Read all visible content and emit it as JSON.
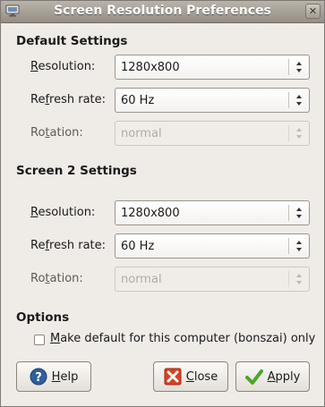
{
  "window": {
    "title": "Screen Resolution Preferences"
  },
  "default_settings": {
    "heading": "Default Settings",
    "resolution": {
      "label_u": "R",
      "label_rest": "esolution:",
      "value": "1280x800"
    },
    "refresh_rate": {
      "label_pre": "Re",
      "label_u": "f",
      "label_rest": "resh rate:",
      "value": "60 Hz"
    },
    "rotation": {
      "label_pre": "Ro",
      "label_u": "t",
      "label_rest": "ation:",
      "value": "normal"
    }
  },
  "screen2_settings": {
    "heading": "Screen 2 Settings",
    "resolution": {
      "label_u": "R",
      "label_rest": "esolution:",
      "value": "1280x800"
    },
    "refresh_rate": {
      "label_pre": "Re",
      "label_u": "f",
      "label_rest": "resh rate:",
      "value": "60 Hz"
    },
    "rotation": {
      "label_pre": "Ro",
      "label_u": "t",
      "label_rest": "ation:",
      "value": "normal"
    }
  },
  "options": {
    "heading": "Options",
    "make_default": {
      "label_u": "M",
      "label_rest": "ake default for this computer (bonszai) only",
      "checked": false
    }
  },
  "buttons": {
    "help": {
      "label_u": "H",
      "label_rest": "elp"
    },
    "close": {
      "label_u": "C",
      "label_rest": "lose"
    },
    "apply": {
      "label_u": "A",
      "label_rest": "pply"
    }
  },
  "icons": {
    "window": "monitor-icon",
    "close": "close-icon",
    "help": "help-icon",
    "close_btn": "close-red-x-icon",
    "apply": "checkmark-icon"
  },
  "colors": {
    "accent_help": "#2f5f9e",
    "close_red": "#d9411e",
    "apply_green": "#4fa52a"
  }
}
